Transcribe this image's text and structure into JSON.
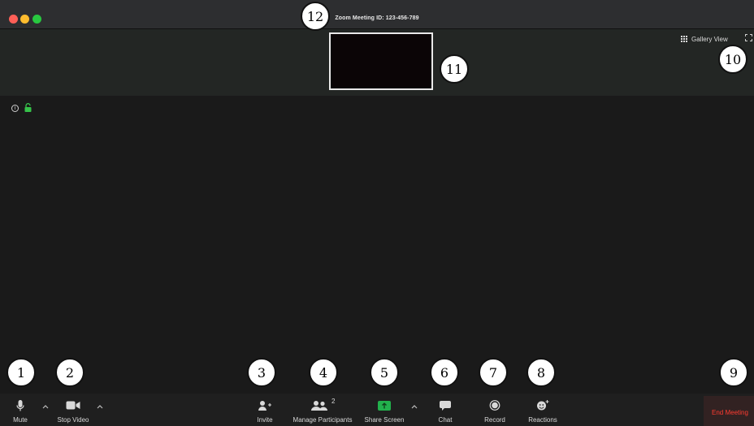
{
  "window": {
    "title": "Zoom Meeting ID: 123-456-789"
  },
  "top_bar": {
    "gallery_view_label": "Gallery View"
  },
  "toolbar": {
    "mute_label": "Mute",
    "stop_video_label": "Stop Video",
    "invite_label": "Invite",
    "manage_participants_label": "Manage Participants",
    "participant_count": "2",
    "share_screen_label": "Share Screen",
    "chat_label": "Chat",
    "record_label": "Record",
    "reactions_label": "Reactions",
    "end_meeting_label": "End Meeting"
  },
  "callouts": [
    "1",
    "2",
    "3",
    "4",
    "5",
    "6",
    "7",
    "8",
    "9",
    "10",
    "11",
    "12"
  ],
  "colors": {
    "end_meeting_text": "#ff3b30",
    "share_screen_green": "#22b14c",
    "lock_green": "#36c24a"
  }
}
